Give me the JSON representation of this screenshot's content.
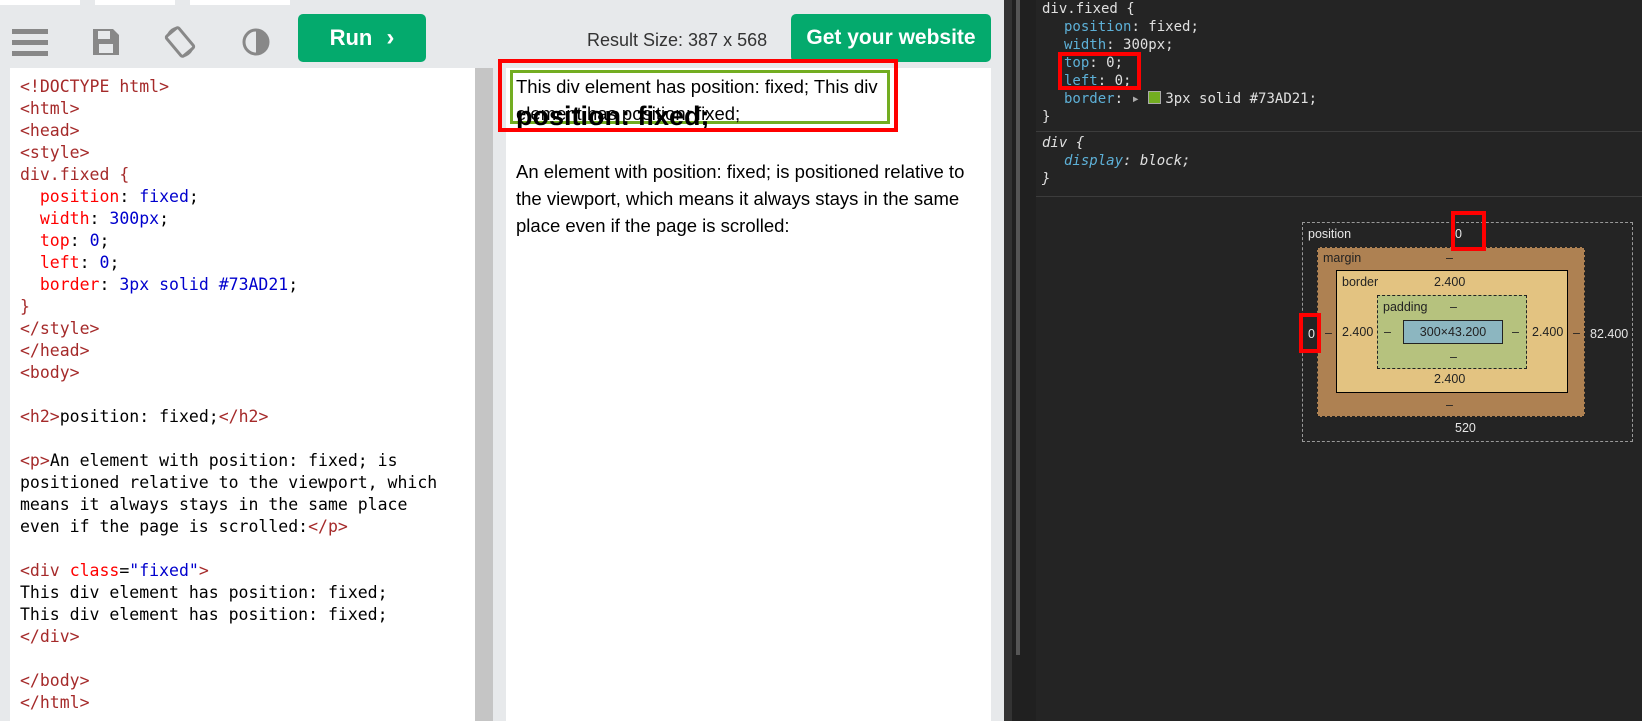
{
  "toolbar": {
    "run_label": "Run",
    "result_size": "Result Size: 387 x 568",
    "get_website_label": "Get your website"
  },
  "editor": {
    "lines": [
      "<!DOCTYPE html>",
      "<html>",
      "<head>",
      "<style>",
      "div.fixed {",
      "  position: fixed;",
      "  width: 300px;",
      "  top: 0;",
      "  left: 0;",
      "  border: 3px solid #73AD21;",
      "}",
      "</style>",
      "</head>",
      "<body>",
      "",
      "<h2>position: fixed;</h2>",
      "",
      "<p>An element with position: fixed; is",
      "positioned relative to the viewport, which",
      "means it always stays in the same place",
      "even if the page is scrolled:</p>",
      "",
      "<div class=\"fixed\">",
      "This div element has position: fixed;",
      "This div element has position: fixed;",
      "</div>",
      "",
      "</body>",
      "</html>"
    ]
  },
  "result": {
    "fixed_text": "This div element has position: fixed; This div element has position: fixed;",
    "heading": "position: fixed;",
    "paragraph": "An element with position: fixed; is positioned relative to the viewport, which means it always stays in the same place even if the page is scrolled:"
  },
  "devtools": {
    "rule1_selector": "div.fixed {",
    "rule1_props": [
      {
        "name": "position",
        "value": "fixed;"
      },
      {
        "name": "width",
        "value": "300px;"
      },
      {
        "name": "top",
        "value": "0;"
      },
      {
        "name": "left",
        "value": "0;"
      },
      {
        "name": "border",
        "value": "3px solid #73AD21;"
      }
    ],
    "close_brace": "}",
    "rule2_selector": "div {",
    "rule2_props": [
      {
        "name": "display",
        "value": "block;"
      }
    ],
    "box_model": {
      "position_label": "position",
      "position_top": "0",
      "position_left": "0",
      "position_right": "82.400",
      "position_bottom": "520",
      "margin_label": "margin",
      "margin_top": "–",
      "margin_left": "–",
      "margin_right": "–",
      "margin_bottom": "–",
      "border_label": "border",
      "border_top": "2.400",
      "border_left": "2.400",
      "border_right": "2.400",
      "border_bottom": "2.400",
      "padding_label": "padding",
      "padding_top": "–",
      "padding_left": "–",
      "padding_right": "–",
      "padding_bottom": "–",
      "content": "300×43.200"
    }
  },
  "colors": {
    "brand_green": "#04aa6d",
    "border_green": "#73AD21",
    "highlight_red": "#ff0000"
  }
}
